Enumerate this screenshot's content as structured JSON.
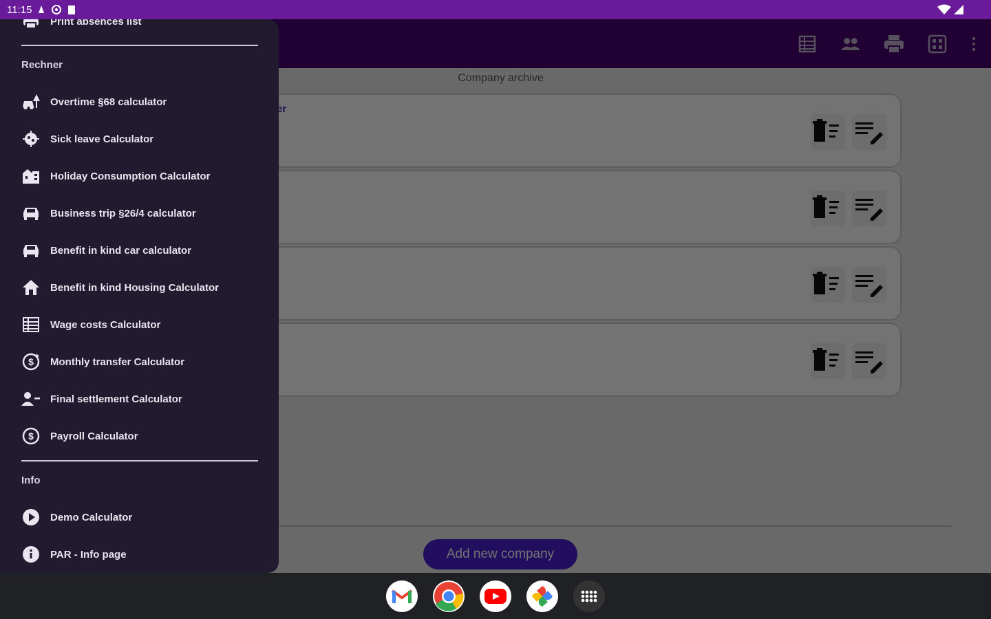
{
  "status_bar": {
    "time": "11:15"
  },
  "app_bar": {
    "actions": [
      "table-icon",
      "people-icon",
      "print-icon",
      "dashboard-icon",
      "more-vert-icon"
    ]
  },
  "main": {
    "archive_title": "Company archive",
    "cards": [
      {
        "text": "er"
      },
      {
        "text": ""
      },
      {
        "text": ""
      },
      {
        "text": ""
      }
    ],
    "add_button": "Add new company"
  },
  "drawer": {
    "top_item": "Print absences list",
    "sections": [
      {
        "title": "Rechner",
        "items": [
          {
            "label": "Overtime §68 calculator",
            "icon": "car-tree-icon"
          },
          {
            "label": "Sick leave Calculator",
            "icon": "virus-icon"
          },
          {
            "label": "Holiday Consumption Calculator",
            "icon": "building-icon"
          },
          {
            "label": "Business trip §26/4 calculator",
            "icon": "car-icon"
          },
          {
            "label": "Benefit in kind car calculator",
            "icon": "car-icon"
          },
          {
            "label": "Benefit in kind Housing Calculator",
            "icon": "house-icon"
          },
          {
            "label": "Wage costs Calculator",
            "icon": "table-icon"
          },
          {
            "label": "Monthly transfer Calculator",
            "icon": "dollar-refresh-icon"
          },
          {
            "label": "Final settlement Calculator",
            "icon": "person-remove-icon"
          },
          {
            "label": "Payroll Calculator",
            "icon": "dollar-circle-icon"
          }
        ]
      },
      {
        "title": "Info",
        "items": [
          {
            "label": "Demo Calculator",
            "icon": "play-circle-icon"
          },
          {
            "label": "PAR - Info page",
            "icon": "info-circle-icon"
          }
        ]
      }
    ]
  },
  "nav_bar": {
    "apps": [
      "gmail-icon",
      "chrome-icon",
      "youtube-icon",
      "photos-icon",
      "app-launcher-icon"
    ]
  },
  "colors": {
    "status_bar": "#6a1b9a",
    "app_bar": "#4a0072",
    "drawer_bg": "#221a2e",
    "accent": "#4a1fd1"
  }
}
